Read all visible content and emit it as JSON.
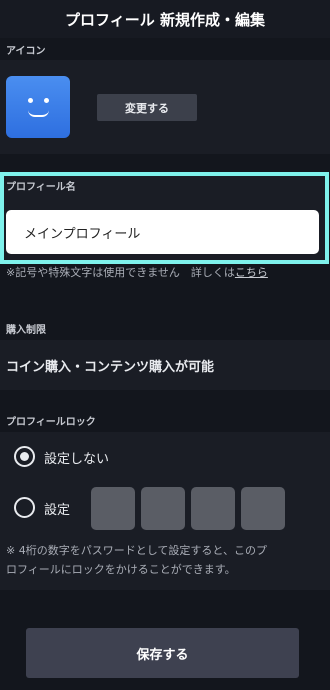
{
  "header": {
    "title": "プロフィール 新規作成・編集"
  },
  "icon_section": {
    "label": "アイコン",
    "avatar_icon": "smiley-face-icon",
    "change_button": "変更する"
  },
  "profile_name": {
    "label": "プロフィール名",
    "value": "メインプロフィール",
    "note": "※記号や特殊文字は使用できません　詳しくは",
    "note_link": "こちら"
  },
  "purchase": {
    "label": "購入制限",
    "value": "コイン購入・コンテンツ購入が可能"
  },
  "lock": {
    "label": "プロフィールロック",
    "option_none": "設定しない",
    "option_set": "設定",
    "selected": "設定しない",
    "note_line1": "※ 4桁の数字をパスワードとして設定すると、このプ",
    "note_line2": "ロフィールにロックをかけることができます。"
  },
  "save_button": "保存する",
  "colors": {
    "background": "#13161d",
    "section": "#1a1d25",
    "highlight": "#7ff2ec",
    "avatar": "#3a7ff0",
    "button": "#3e4150"
  }
}
